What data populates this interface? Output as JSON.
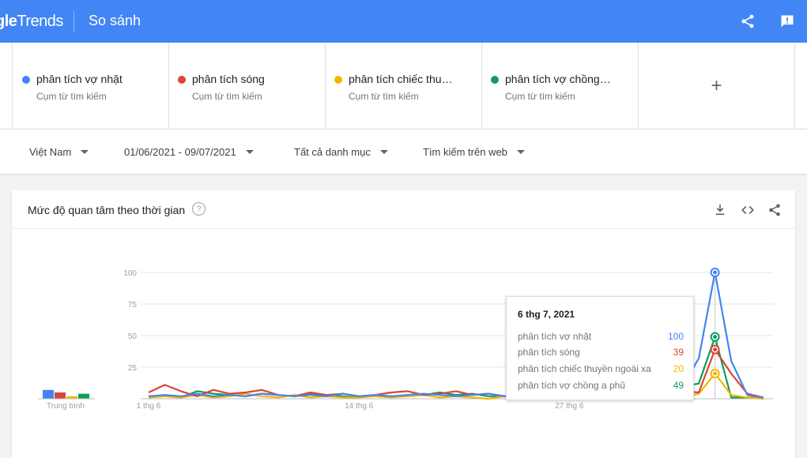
{
  "header": {
    "brand_part1": "gle",
    "brand_part2": "Trends",
    "page_title": "So sánh"
  },
  "terms": [
    {
      "name": "phân tích vợ nhặt",
      "sub": "Cụm từ tìm kiếm",
      "color": "#4285f4"
    },
    {
      "name": "phân tích sóng",
      "sub": "Cụm từ tìm kiếm",
      "color": "#db4437"
    },
    {
      "name": "phân tích chiếc thu…",
      "sub": "Cụm từ tìm kiếm",
      "color": "#f4b400"
    },
    {
      "name": "phân tích vợ chồng…",
      "sub": "Cụm từ tìm kiếm",
      "color": "#0f9d58"
    }
  ],
  "add_term": "+",
  "filters": {
    "region": "Việt Nam",
    "date_range": "01/06/2021 - 09/07/2021",
    "category": "Tất cả danh mục",
    "search_type": "Tìm kiếm trên web"
  },
  "card": {
    "title": "Mức độ quan tâm theo thời gian",
    "help": "?"
  },
  "tooltip": {
    "date": "6 thg 7, 2021",
    "rows": [
      {
        "label": "phân tích vợ nhặt",
        "value": "100",
        "color": "#4285f4"
      },
      {
        "label": "phân tích sóng",
        "value": "39",
        "color": "#db4437"
      },
      {
        "label": "phân tích chiếc thuyền ngoài xa",
        "value": "20",
        "color": "#f4b400"
      },
      {
        "label": "phân tích vợ chồng a phủ",
        "value": "49",
        "color": "#0f9d58"
      }
    ]
  },
  "chart_data": {
    "type": "line",
    "x": [
      "1 thg 6",
      "2 thg 6",
      "3 thg 6",
      "4 thg 6",
      "5 thg 6",
      "6 thg 6",
      "7 thg 6",
      "8 thg 6",
      "9 thg 6",
      "10 thg 6",
      "11 thg 6",
      "12 thg 6",
      "13 thg 6",
      "14 thg 6",
      "15 thg 6",
      "16 thg 6",
      "17 thg 6",
      "18 thg 6",
      "19 thg 6",
      "20 thg 6",
      "21 thg 6",
      "22 thg 6",
      "23 thg 6",
      "24 thg 6",
      "25 thg 6",
      "26 thg 6",
      "27 thg 6",
      "28 thg 6",
      "29 thg 6",
      "30 thg 6",
      "1 thg 7",
      "2 thg 7",
      "3 thg 7",
      "4 thg 7",
      "5 thg 7",
      "6 thg 7",
      "7 thg 7",
      "8 thg 7",
      "9 thg 7"
    ],
    "x_tick_labels": [
      "1 thg 6",
      "14 thg 6",
      "27 thg 6"
    ],
    "x_tick_index": [
      0,
      13,
      26
    ],
    "y_ticks": [
      25,
      50,
      75,
      100
    ],
    "ylim": [
      0,
      100
    ],
    "average_label": "Trung bình",
    "averages": [
      7,
      5,
      2,
      4
    ],
    "series": [
      {
        "name": "phân tích vợ nhặt",
        "color": "#4285f4",
        "values": [
          2,
          3,
          2,
          4,
          2,
          3,
          2,
          4,
          3,
          2,
          3,
          2,
          4,
          2,
          3,
          2,
          3,
          4,
          3,
          2,
          3,
          4,
          2,
          3,
          2,
          3,
          4,
          3,
          5,
          6,
          4,
          8,
          14,
          10,
          32,
          100,
          30,
          3,
          1
        ]
      },
      {
        "name": "phân tích sóng",
        "color": "#db4437",
        "values": [
          5,
          11,
          6,
          2,
          7,
          4,
          5,
          7,
          3,
          2,
          5,
          3,
          4,
          2,
          3,
          5,
          6,
          3,
          4,
          6,
          3,
          4,
          2,
          3,
          4,
          5,
          3,
          4,
          2,
          3,
          3,
          5,
          4,
          6,
          5,
          39,
          20,
          4,
          1
        ]
      },
      {
        "name": "phân tích chiếc thuyền ngoài xa",
        "color": "#f4b400",
        "values": [
          1,
          2,
          1,
          3,
          1,
          2,
          4,
          2,
          1,
          3,
          1,
          2,
          1,
          1,
          2,
          1,
          2,
          3,
          1,
          2,
          1,
          0,
          2,
          1,
          2,
          1,
          3,
          1,
          2,
          1,
          1,
          2,
          3,
          1,
          4,
          20,
          3,
          1,
          0
        ]
      },
      {
        "name": "phân tích vợ chồng a phủ",
        "color": "#0f9d58",
        "values": [
          1,
          2,
          1,
          6,
          4,
          3,
          2,
          4,
          3,
          2,
          4,
          3,
          2,
          1,
          3,
          2,
          2,
          3,
          5,
          3,
          4,
          2,
          2,
          3,
          2,
          4,
          3,
          2,
          3,
          2,
          2,
          3,
          5,
          10,
          12,
          49,
          1,
          1,
          1
        ]
      }
    ]
  }
}
